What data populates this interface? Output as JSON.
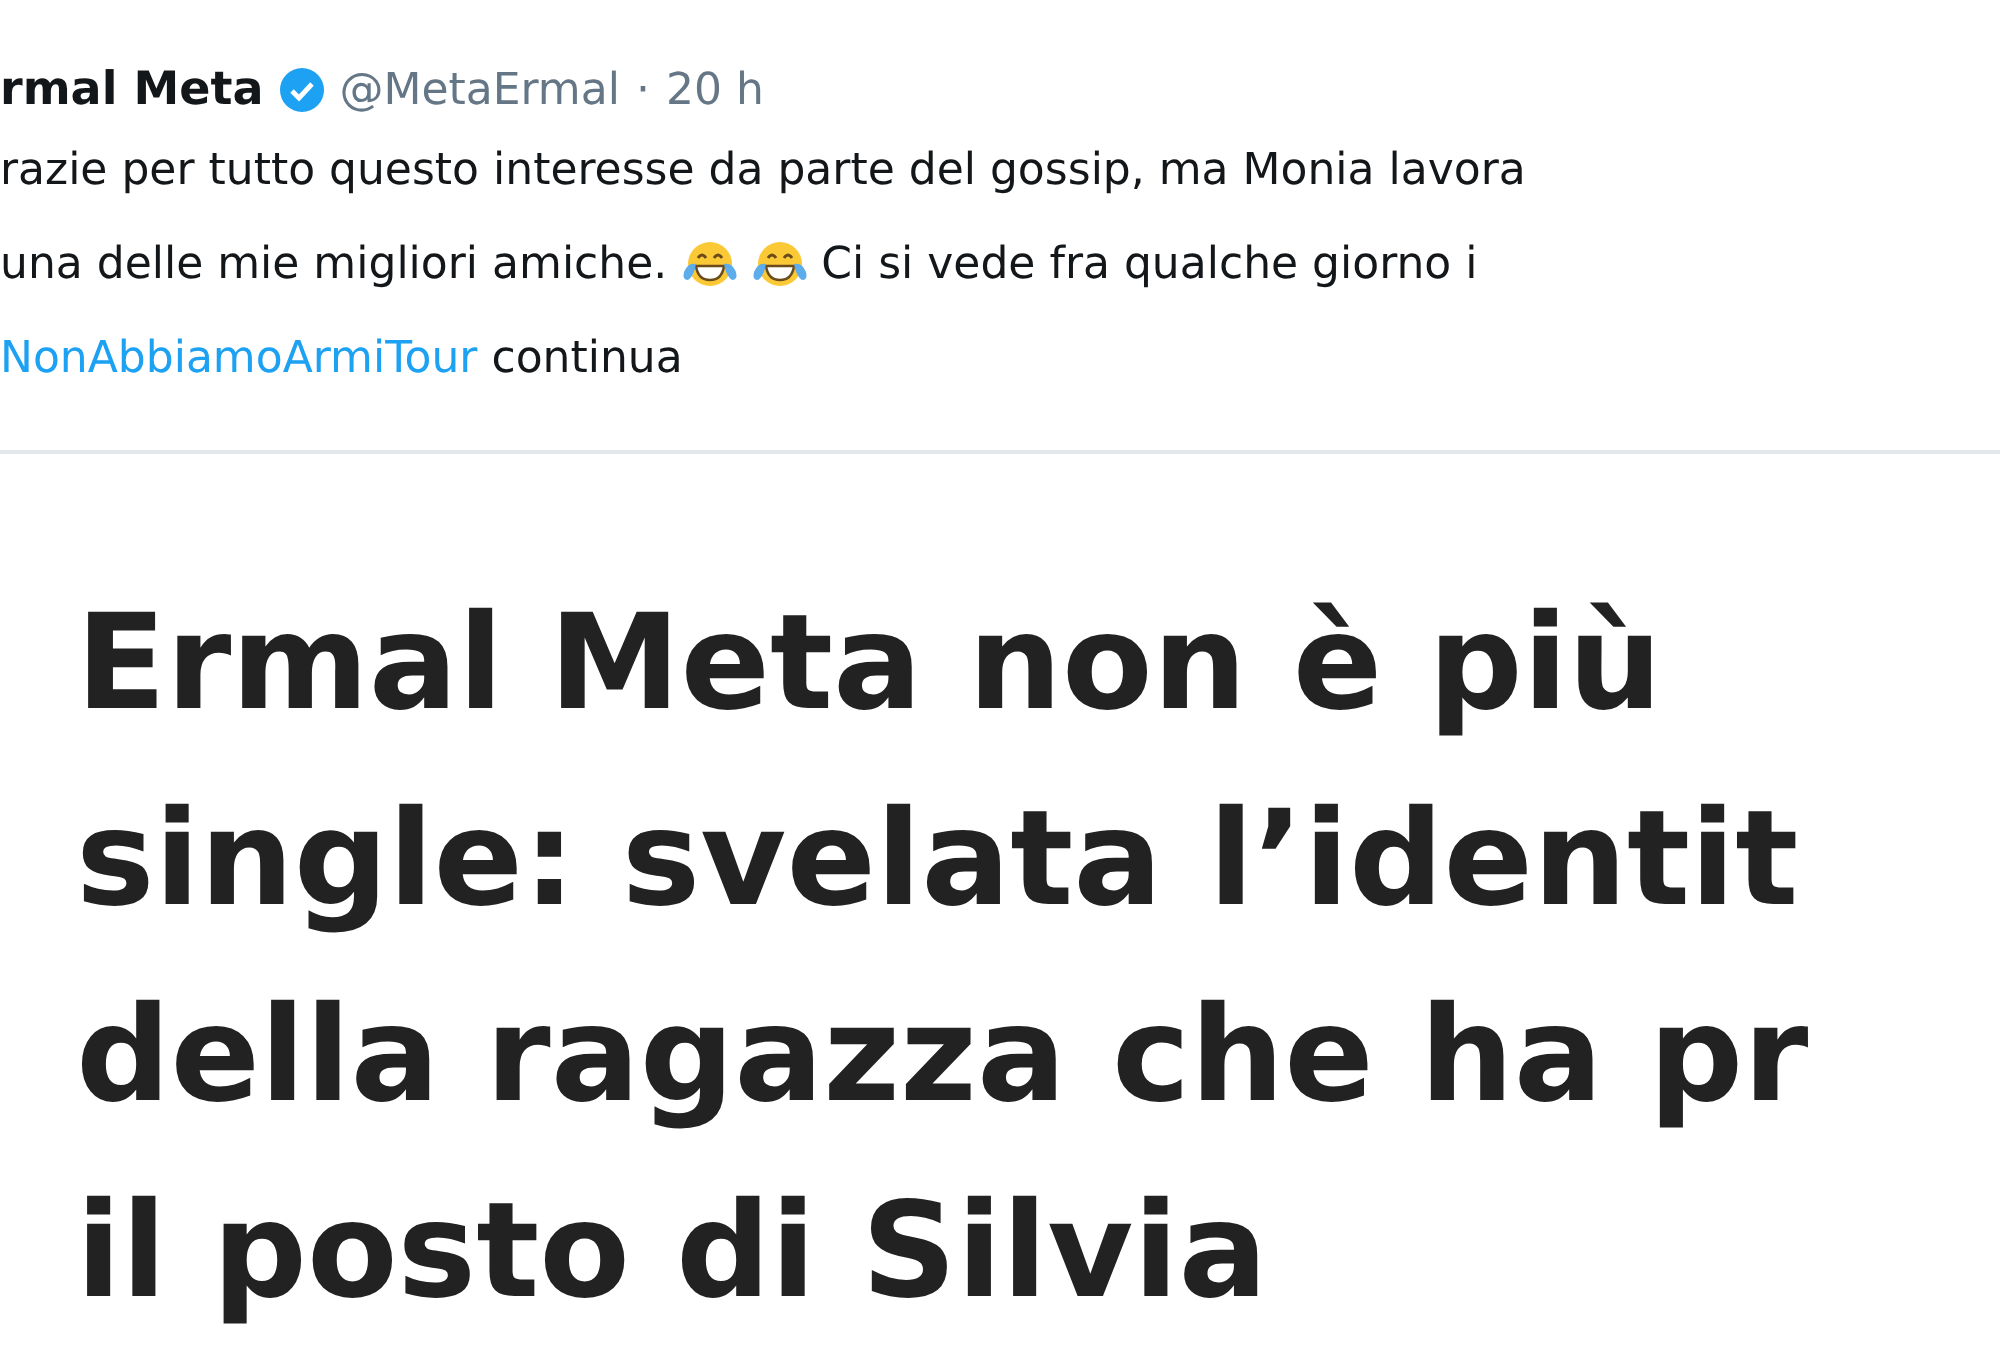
{
  "tweet": {
    "author": "rmal Meta",
    "verified": true,
    "handle": "@MetaErmal",
    "separator": "·",
    "time": "20 h",
    "lines": [
      {
        "parts": [
          {
            "kind": "text",
            "text": "razie per tutto questo interesse da parte del gossip, ma Monia lavora"
          }
        ]
      },
      {
        "parts": [
          {
            "kind": "text",
            "text": "una delle mie migliori amiche."
          },
          {
            "kind": "emoji"
          },
          {
            "kind": "emoji"
          },
          {
            "kind": "text",
            "text": "Ci si vede fra qualche giorno i"
          }
        ]
      },
      {
        "parts": [
          {
            "kind": "hashtag",
            "text": "NonAbbiamoArmiTour"
          },
          {
            "kind": "text",
            "text": "continua"
          }
        ]
      }
    ]
  },
  "card": {
    "headline": [
      "Ermal Meta non è più",
      "single: svelata l’identit",
      "della ragazza che ha pr",
      "il posto di Silvia"
    ]
  }
}
